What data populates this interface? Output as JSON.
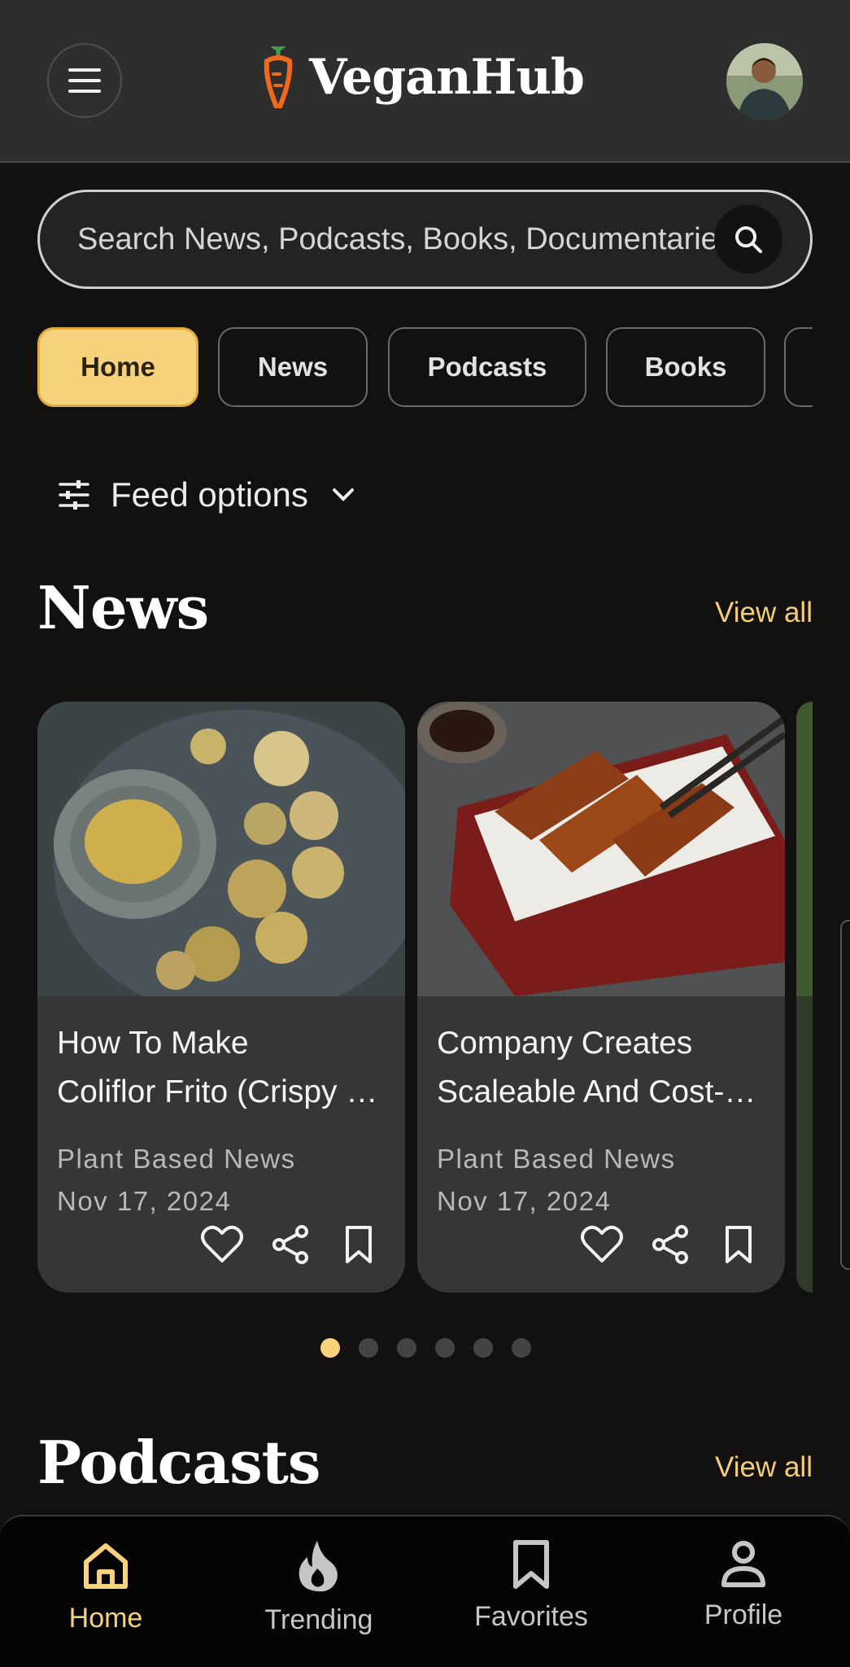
{
  "app": {
    "name": "VeganHub"
  },
  "search": {
    "placeholder": "Search News, Podcasts, Books, Documentaries"
  },
  "tabs": [
    {
      "label": "Home",
      "active": true
    },
    {
      "label": "News"
    },
    {
      "label": "Podcasts"
    },
    {
      "label": "Books"
    }
  ],
  "feed_options": {
    "label": "Feed options"
  },
  "news": {
    "title": "News",
    "view_all": "View all",
    "cards": [
      {
        "title_line1": "How To Make",
        "title_line2": "Coliflor Frito (Crispy Cauliflower)",
        "source": "Plant Based News",
        "date": "Nov 17, 2024"
      },
      {
        "title_line1": "Company Creates",
        "title_line2": "Scaleable And Cost-Effective",
        "source": "Plant Based News",
        "date": "Nov 17, 2024"
      }
    ],
    "pagination": {
      "current": 1,
      "total": 6
    }
  },
  "podcasts": {
    "title": "Podcasts",
    "view_all": "View all"
  },
  "bottom_nav": [
    {
      "label": "Home",
      "icon": "home-icon",
      "active": true
    },
    {
      "label": "Trending",
      "icon": "flame-icon"
    },
    {
      "label": "Favorites",
      "icon": "bookmark-icon"
    },
    {
      "label": "Profile",
      "icon": "person-icon"
    }
  ],
  "colors": {
    "accent": "#f7d27c",
    "background": "#121110",
    "header": "#2e2e2d",
    "card": "#363635"
  }
}
